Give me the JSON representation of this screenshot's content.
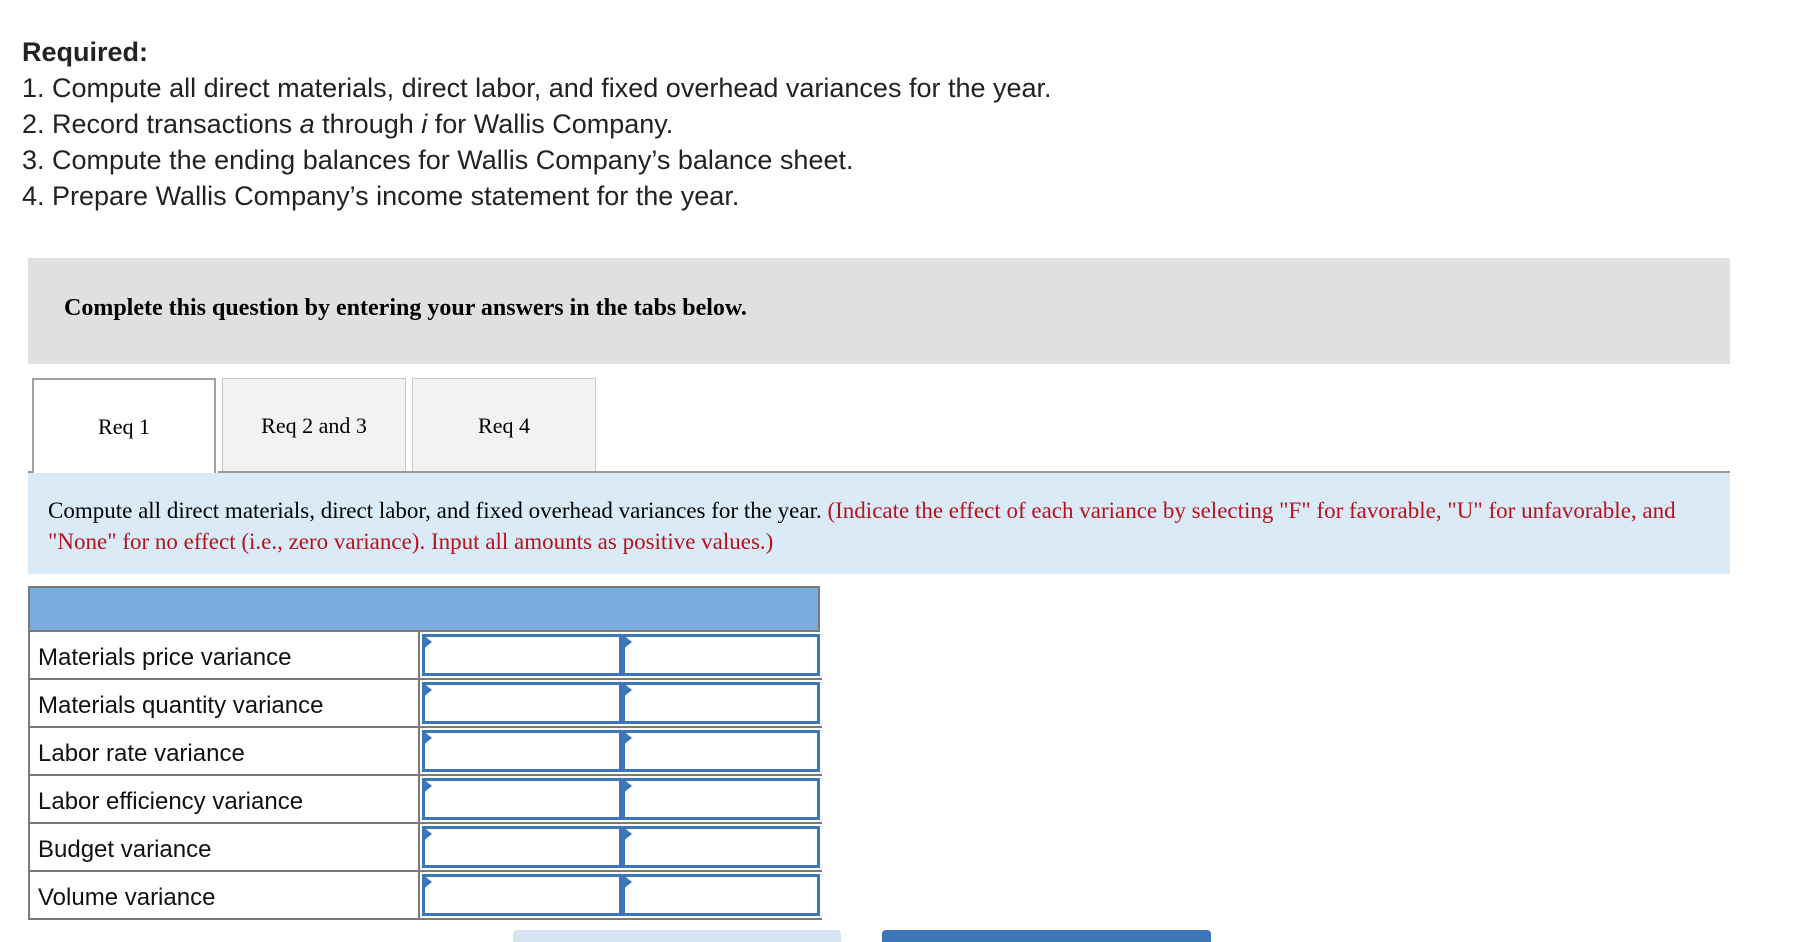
{
  "required": {
    "heading": "Required:",
    "items": [
      "1. Compute all direct materials, direct labor, and fixed overhead variances for the year.",
      {
        "prefix": "2. Record transactions ",
        "a": "a",
        "mid": " through ",
        "i": "i",
        "suffix": " for Wallis Company."
      },
      "3. Compute the ending balances for Wallis Company’s balance sheet.",
      "4. Prepare Wallis Company’s income statement for the year."
    ]
  },
  "instruction": "Complete this question by entering your answers in the tabs below.",
  "tabs": [
    {
      "label": "Req 1",
      "active": true
    },
    {
      "label": "Req 2 and 3",
      "active": false
    },
    {
      "label": "Req 4",
      "active": false
    }
  ],
  "question": {
    "text": "Compute all direct materials, direct labor, and fixed overhead variances for the year.",
    "note": "(Indicate the effect of each variance by selecting \"F\" for favorable, \"U\" for unfavorable, and \"None\" for no effect (i.e., zero variance). Input all amounts as positive values.)"
  },
  "table": {
    "rows": [
      {
        "label": "Materials price variance",
        "amount": "",
        "effect": ""
      },
      {
        "label": "Materials quantity variance",
        "amount": "",
        "effect": ""
      },
      {
        "label": "Labor rate variance",
        "amount": "",
        "effect": ""
      },
      {
        "label": "Labor efficiency variance",
        "amount": "",
        "effect": ""
      },
      {
        "label": "Budget variance",
        "amount": "",
        "effect": ""
      },
      {
        "label": "Volume variance",
        "amount": "",
        "effect": ""
      }
    ]
  },
  "colors": {
    "header_blue": "#7badde",
    "input_border": "#3a76b8",
    "note_red": "#b5121b",
    "question_bg": "#dbeaf7",
    "instruction_bg": "#e0e0e0"
  }
}
